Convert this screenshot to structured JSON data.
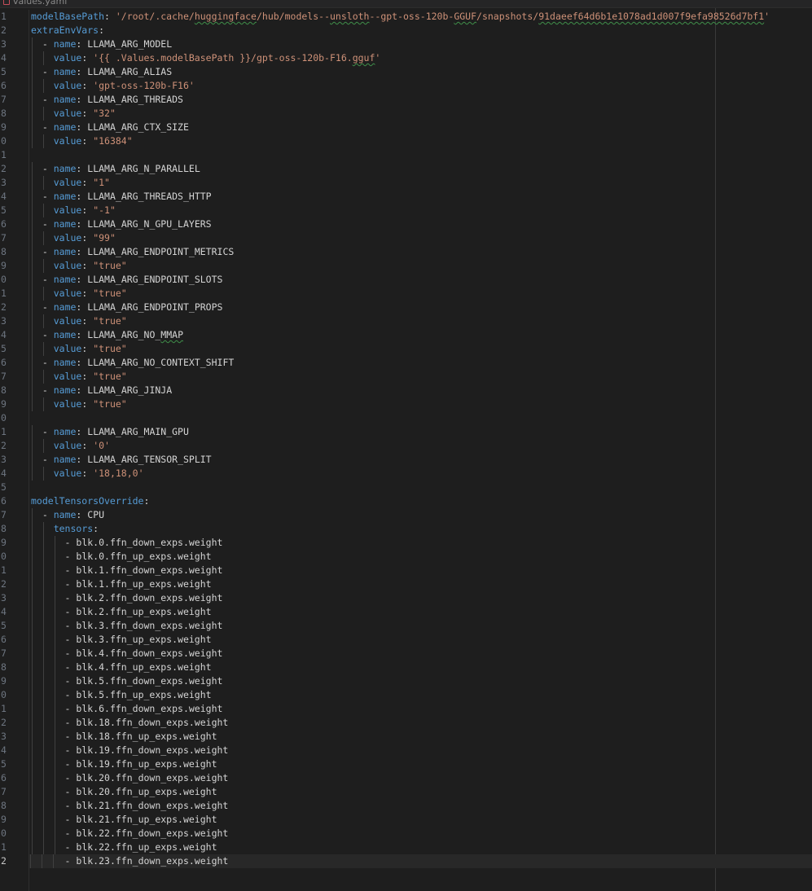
{
  "editor": {
    "tab_title": "values.yaml",
    "active_line": 62,
    "colors": {
      "background": "#1e1e1e",
      "key": "#569cd6",
      "string": "#ce9178",
      "plain": "#d4d4d4",
      "line_number": "#6e7681"
    }
  },
  "lines": [
    {
      "n": "1",
      "indent": 0,
      "key": "modelBasePath",
      "sep": ": ",
      "value": "'/root/.cache/huggingface/hub/models--unsloth--gpt-oss-120b-GGUF/snapshots/91daeef64d6b1e1078ad1d007f9efa98526d7bf1'",
      "vtype": "s"
    },
    {
      "n": "2",
      "indent": 0,
      "key": "extraEnvVars",
      "sep": ":",
      "value": "",
      "vtype": "t"
    },
    {
      "n": "3",
      "indent": 2,
      "dash": true,
      "key": "name",
      "sep": ": ",
      "value": "LLAMA_ARG_MODEL",
      "vtype": "t"
    },
    {
      "n": "4",
      "indent": 4,
      "key": "value",
      "sep": ": ",
      "value": "'{{ .Values.modelBasePath }}/gpt-oss-120b-F16.gguf'",
      "vtype": "s"
    },
    {
      "n": "5",
      "indent": 2,
      "dash": true,
      "key": "name",
      "sep": ": ",
      "value": "LLAMA_ARG_ALIAS",
      "vtype": "t"
    },
    {
      "n": "6",
      "indent": 4,
      "key": "value",
      "sep": ": ",
      "value": "'gpt-oss-120b-F16'",
      "vtype": "s"
    },
    {
      "n": "7",
      "indent": 2,
      "dash": true,
      "key": "name",
      "sep": ": ",
      "value": "LLAMA_ARG_THREADS",
      "vtype": "t"
    },
    {
      "n": "8",
      "indent": 4,
      "key": "value",
      "sep": ": ",
      "value": "\"32\"",
      "vtype": "s"
    },
    {
      "n": "9",
      "indent": 2,
      "dash": true,
      "key": "name",
      "sep": ": ",
      "value": "LLAMA_ARG_CTX_SIZE",
      "vtype": "t"
    },
    {
      "n": "0",
      "indent": 4,
      "key": "value",
      "sep": ": ",
      "value": "\"16384\"",
      "vtype": "s"
    },
    {
      "n": "1",
      "indent": 0,
      "key": "",
      "sep": "",
      "value": "",
      "vtype": "t"
    },
    {
      "n": "2",
      "indent": 2,
      "dash": true,
      "key": "name",
      "sep": ": ",
      "value": "LLAMA_ARG_N_PARALLEL",
      "vtype": "t"
    },
    {
      "n": "3",
      "indent": 4,
      "key": "value",
      "sep": ": ",
      "value": "\"1\"",
      "vtype": "s"
    },
    {
      "n": "4",
      "indent": 2,
      "dash": true,
      "key": "name",
      "sep": ": ",
      "value": "LLAMA_ARG_THREADS_HTTP",
      "vtype": "t"
    },
    {
      "n": "5",
      "indent": 4,
      "key": "value",
      "sep": ": ",
      "value": "\"-1\"",
      "vtype": "s"
    },
    {
      "n": "6",
      "indent": 2,
      "dash": true,
      "key": "name",
      "sep": ": ",
      "value": "LLAMA_ARG_N_GPU_LAYERS",
      "vtype": "t"
    },
    {
      "n": "7",
      "indent": 4,
      "key": "value",
      "sep": ": ",
      "value": "\"99\"",
      "vtype": "s"
    },
    {
      "n": "8",
      "indent": 2,
      "dash": true,
      "key": "name",
      "sep": ": ",
      "value": "LLAMA_ARG_ENDPOINT_METRICS",
      "vtype": "t"
    },
    {
      "n": "9",
      "indent": 4,
      "key": "value",
      "sep": ": ",
      "value": "\"true\"",
      "vtype": "s"
    },
    {
      "n": "0",
      "indent": 2,
      "dash": true,
      "key": "name",
      "sep": ": ",
      "value": "LLAMA_ARG_ENDPOINT_SLOTS",
      "vtype": "t"
    },
    {
      "n": "1",
      "indent": 4,
      "key": "value",
      "sep": ": ",
      "value": "\"true\"",
      "vtype": "s"
    },
    {
      "n": "2",
      "indent": 2,
      "dash": true,
      "key": "name",
      "sep": ": ",
      "value": "LLAMA_ARG_ENDPOINT_PROPS",
      "vtype": "t"
    },
    {
      "n": "3",
      "indent": 4,
      "key": "value",
      "sep": ": ",
      "value": "\"true\"",
      "vtype": "s"
    },
    {
      "n": "4",
      "indent": 2,
      "dash": true,
      "key": "name",
      "sep": ": ",
      "value": "LLAMA_ARG_NO_MMAP",
      "vtype": "t"
    },
    {
      "n": "5",
      "indent": 4,
      "key": "value",
      "sep": ": ",
      "value": "\"true\"",
      "vtype": "s"
    },
    {
      "n": "6",
      "indent": 2,
      "dash": true,
      "key": "name",
      "sep": ": ",
      "value": "LLAMA_ARG_NO_CONTEXT_SHIFT",
      "vtype": "t"
    },
    {
      "n": "7",
      "indent": 4,
      "key": "value",
      "sep": ": ",
      "value": "\"true\"",
      "vtype": "s"
    },
    {
      "n": "8",
      "indent": 2,
      "dash": true,
      "key": "name",
      "sep": ": ",
      "value": "LLAMA_ARG_JINJA",
      "vtype": "t"
    },
    {
      "n": "9",
      "indent": 4,
      "key": "value",
      "sep": ": ",
      "value": "\"true\"",
      "vtype": "s"
    },
    {
      "n": "0",
      "indent": 0,
      "key": "",
      "sep": "",
      "value": "",
      "vtype": "t"
    },
    {
      "n": "1",
      "indent": 2,
      "dash": true,
      "key": "name",
      "sep": ": ",
      "value": "LLAMA_ARG_MAIN_GPU",
      "vtype": "t"
    },
    {
      "n": "2",
      "indent": 4,
      "key": "value",
      "sep": ": ",
      "value": "'0'",
      "vtype": "s"
    },
    {
      "n": "3",
      "indent": 2,
      "dash": true,
      "key": "name",
      "sep": ": ",
      "value": "LLAMA_ARG_TENSOR_SPLIT",
      "vtype": "t"
    },
    {
      "n": "4",
      "indent": 4,
      "key": "value",
      "sep": ": ",
      "value": "'18,18,0'",
      "vtype": "s"
    },
    {
      "n": "5",
      "indent": 0,
      "key": "",
      "sep": "",
      "value": "",
      "vtype": "t"
    },
    {
      "n": "6",
      "indent": 0,
      "key": "modelTensorsOverride",
      "sep": ":",
      "value": "",
      "vtype": "t"
    },
    {
      "n": "7",
      "indent": 2,
      "dash": true,
      "key": "name",
      "sep": ": ",
      "value": "CPU",
      "vtype": "t"
    },
    {
      "n": "8",
      "indent": 4,
      "key": "tensors",
      "sep": ":",
      "value": "",
      "vtype": "t"
    },
    {
      "n": "9",
      "indent": 6,
      "dash": true,
      "key": "",
      "sep": "",
      "value": "blk.0.ffn_down_exps.weight",
      "vtype": "t"
    },
    {
      "n": "0",
      "indent": 6,
      "dash": true,
      "key": "",
      "sep": "",
      "value": "blk.0.ffn_up_exps.weight",
      "vtype": "t"
    },
    {
      "n": "1",
      "indent": 6,
      "dash": true,
      "key": "",
      "sep": "",
      "value": "blk.1.ffn_down_exps.weight",
      "vtype": "t"
    },
    {
      "n": "2",
      "indent": 6,
      "dash": true,
      "key": "",
      "sep": "",
      "value": "blk.1.ffn_up_exps.weight",
      "vtype": "t"
    },
    {
      "n": "3",
      "indent": 6,
      "dash": true,
      "key": "",
      "sep": "",
      "value": "blk.2.ffn_down_exps.weight",
      "vtype": "t"
    },
    {
      "n": "4",
      "indent": 6,
      "dash": true,
      "key": "",
      "sep": "",
      "value": "blk.2.ffn_up_exps.weight",
      "vtype": "t"
    },
    {
      "n": "5",
      "indent": 6,
      "dash": true,
      "key": "",
      "sep": "",
      "value": "blk.3.ffn_down_exps.weight",
      "vtype": "t"
    },
    {
      "n": "6",
      "indent": 6,
      "dash": true,
      "key": "",
      "sep": "",
      "value": "blk.3.ffn_up_exps.weight",
      "vtype": "t"
    },
    {
      "n": "7",
      "indent": 6,
      "dash": true,
      "key": "",
      "sep": "",
      "value": "blk.4.ffn_down_exps.weight",
      "vtype": "t"
    },
    {
      "n": "8",
      "indent": 6,
      "dash": true,
      "key": "",
      "sep": "",
      "value": "blk.4.ffn_up_exps.weight",
      "vtype": "t"
    },
    {
      "n": "9",
      "indent": 6,
      "dash": true,
      "key": "",
      "sep": "",
      "value": "blk.5.ffn_down_exps.weight",
      "vtype": "t"
    },
    {
      "n": "0",
      "indent": 6,
      "dash": true,
      "key": "",
      "sep": "",
      "value": "blk.5.ffn_up_exps.weight",
      "vtype": "t"
    },
    {
      "n": "1",
      "indent": 6,
      "dash": true,
      "key": "",
      "sep": "",
      "value": "blk.6.ffn_down_exps.weight",
      "vtype": "t"
    },
    {
      "n": "2",
      "indent": 6,
      "dash": true,
      "key": "",
      "sep": "",
      "value": "blk.18.ffn_down_exps.weight",
      "vtype": "t"
    },
    {
      "n": "3",
      "indent": 6,
      "dash": true,
      "key": "",
      "sep": "",
      "value": "blk.18.ffn_up_exps.weight",
      "vtype": "t"
    },
    {
      "n": "4",
      "indent": 6,
      "dash": true,
      "key": "",
      "sep": "",
      "value": "blk.19.ffn_down_exps.weight",
      "vtype": "t"
    },
    {
      "n": "5",
      "indent": 6,
      "dash": true,
      "key": "",
      "sep": "",
      "value": "blk.19.ffn_up_exps.weight",
      "vtype": "t"
    },
    {
      "n": "6",
      "indent": 6,
      "dash": true,
      "key": "",
      "sep": "",
      "value": "blk.20.ffn_down_exps.weight",
      "vtype": "t"
    },
    {
      "n": "7",
      "indent": 6,
      "dash": true,
      "key": "",
      "sep": "",
      "value": "blk.20.ffn_up_exps.weight",
      "vtype": "t"
    },
    {
      "n": "8",
      "indent": 6,
      "dash": true,
      "key": "",
      "sep": "",
      "value": "blk.21.ffn_down_exps.weight",
      "vtype": "t"
    },
    {
      "n": "9",
      "indent": 6,
      "dash": true,
      "key": "",
      "sep": "",
      "value": "blk.21.ffn_up_exps.weight",
      "vtype": "t"
    },
    {
      "n": "0",
      "indent": 6,
      "dash": true,
      "key": "",
      "sep": "",
      "value": "blk.22.ffn_down_exps.weight",
      "vtype": "t"
    },
    {
      "n": "1",
      "indent": 6,
      "dash": true,
      "key": "",
      "sep": "",
      "value": "blk.22.ffn_up_exps.weight",
      "vtype": "t"
    },
    {
      "n": "2",
      "indent": 6,
      "dash": true,
      "key": "",
      "sep": "",
      "value": "blk.23.ffn_down_exps.weight",
      "vtype": "t"
    }
  ]
}
